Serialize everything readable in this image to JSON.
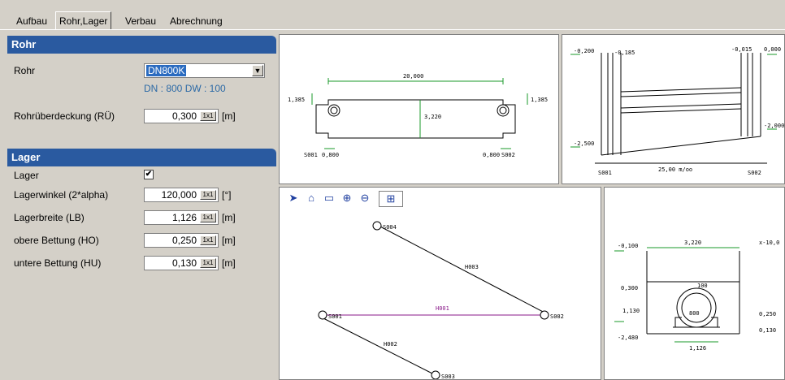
{
  "tabs": [
    "Aufbau",
    "Rohr,Lager",
    "Verbau",
    "Abrechnung"
  ],
  "rohr": {
    "title": "Rohr",
    "rohr_label": "Rohr",
    "rohr_value": "DN800K",
    "dn_info": "DN : 800  DW : 100",
    "ru_label": "Rohrüberdeckung (RÜ)",
    "ru_value": "0,300",
    "unit_btn": "1x1",
    "unit_m": "[m]"
  },
  "lager": {
    "title": "Lager",
    "lager_label": "Lager",
    "checked": "✔",
    "rows": [
      {
        "label": "Lagerwinkel (2*alpha)",
        "value": "120,000",
        "unit": "[°]"
      },
      {
        "label": "Lagerbreite (LB)",
        "value": "1,126",
        "unit": "[m]"
      },
      {
        "label": "obere Bettung (HO)",
        "value": "0,250",
        "unit": "[m]"
      },
      {
        "label": "untere Bettung (HU)",
        "value": "0,130",
        "unit": "[m]"
      }
    ]
  },
  "plan": {
    "width": "20,000",
    "height": "3,220",
    "left_h": "1,385",
    "right_h": "1,385",
    "left_node": "S001",
    "right_node": "S002",
    "left_off": "0,800",
    "right_off": "0,800"
  },
  "profile": {
    "tl": "-0,200",
    "tl2": "-0,185",
    "tr": "-0,015",
    "tr2": "0,000",
    "bl": "-2,500",
    "br": "-2,000",
    "node_left": "S001",
    "node_right": "S002",
    "slope": "25,00 m/oo"
  },
  "network": {
    "nodes": [
      "S004",
      "S001",
      "S002",
      "S003"
    ],
    "edges": [
      "H003",
      "H001",
      "H002"
    ]
  },
  "section": {
    "top_left": "-0,100",
    "width": "3,220",
    "top_right": "x-10,0",
    "cover": "0,300",
    "wall": "100",
    "pipe": "800",
    "depth": "1,130",
    "bottom": "-2,480",
    "bed_width": "1,126",
    "ho": "0,250",
    "hu": "0,130"
  },
  "colors": {
    "header": "#2a5aa0",
    "green": "#1a9a2a",
    "purple": "#8a1a8a"
  }
}
